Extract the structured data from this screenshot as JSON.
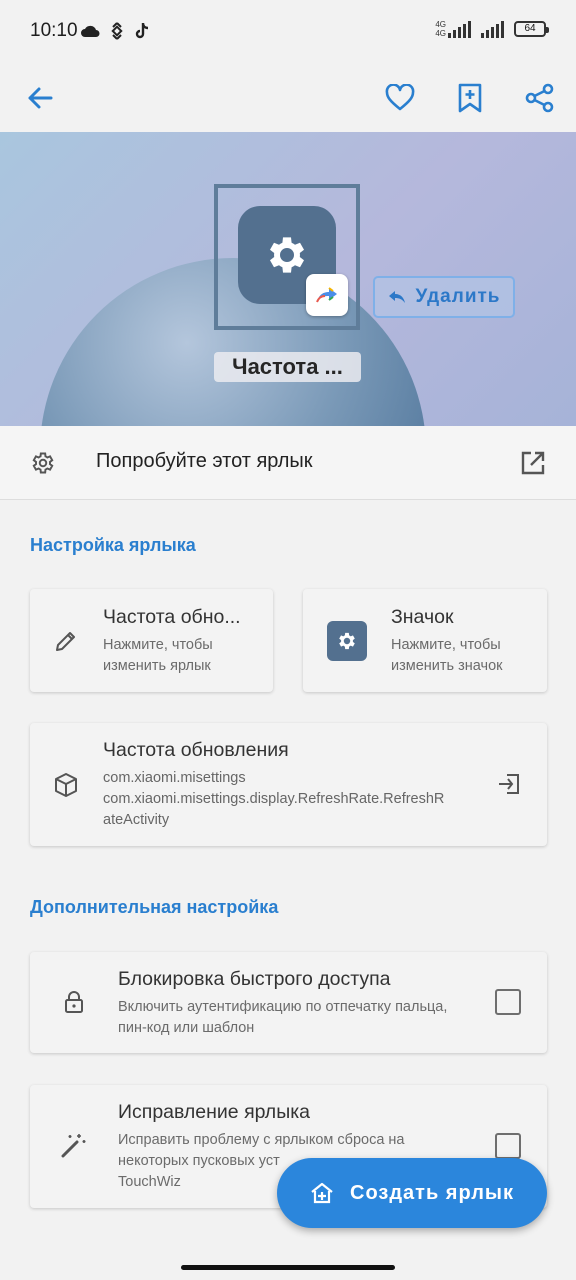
{
  "status_bar": {
    "time": "10:10",
    "network_top": "4G",
    "network_bottom": "4G",
    "battery": "64"
  },
  "app_bar": {
    "back_icon": "arrow-left-icon",
    "favorite_icon": "heart-icon",
    "bookmark_icon": "bookmark-add-icon",
    "share_icon": "share-icon",
    "accent": "#2a7fcf"
  },
  "hero": {
    "delete_label": "Удалить",
    "shortcut_name": "Частота ..."
  },
  "try_row": {
    "label": "Попробуйте этот ярлык"
  },
  "sections": {
    "shortcut_settings": "Настройка ярлыка",
    "advanced_settings": "Дополнительная настройка"
  },
  "cards": {
    "name": {
      "title": "Частота обно...",
      "subtitle": "Нажмите, чтобы изменить ярлык"
    },
    "icon": {
      "title": "Значок",
      "subtitle": "Нажмите, чтобы изменить значок"
    },
    "activity": {
      "title": "Частота обновления",
      "package": "com.xiaomi.misettings",
      "class_line1": "com.xiaomi.misettings.display.RefreshRate.RefreshR",
      "class_line2": "ateActivity"
    },
    "lock": {
      "title": "Блокировка быстрого доступа",
      "subtitle": "Включить аутентификацию по отпечатку пальца, пин-код или шаблон"
    },
    "fix": {
      "title": "Исправление ярлыка",
      "subtitle_line1": "Исправить проблему с ярлыком сброса на",
      "subtitle_line2": "некоторых пусковых уст",
      "subtitle_line3": "TouchWiz"
    }
  },
  "fab": {
    "label": "Создать ярлык"
  }
}
